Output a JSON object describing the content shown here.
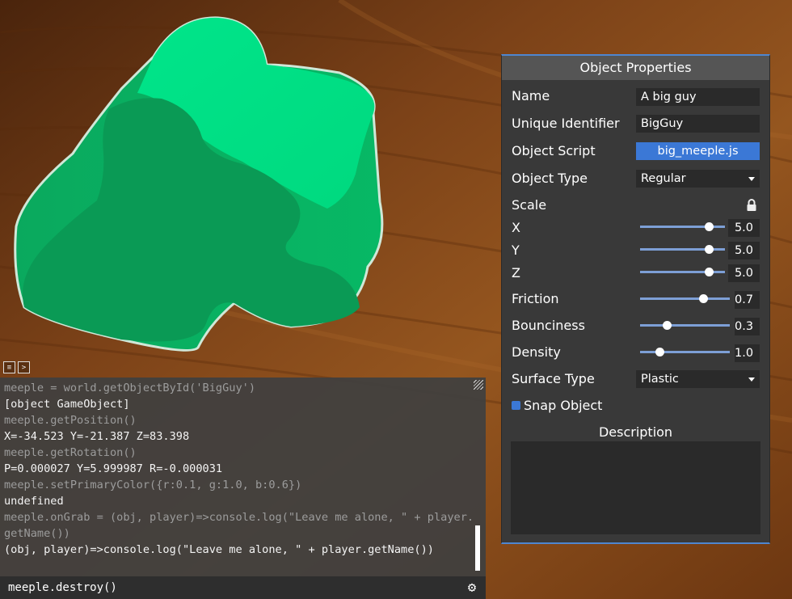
{
  "console": {
    "lines": [
      {
        "type": "cmd",
        "text": "meeple = world.getObjectById('BigGuy')"
      },
      {
        "type": "out",
        "text": "[object GameObject]"
      },
      {
        "type": "cmd",
        "text": "meeple.getPosition()"
      },
      {
        "type": "out",
        "text": "X=-34.523 Y=-21.387 Z=83.398"
      },
      {
        "type": "cmd",
        "text": "meeple.getRotation()"
      },
      {
        "type": "out",
        "text": "P=0.000027 Y=5.999987 R=-0.000031"
      },
      {
        "type": "cmd",
        "text": "meeple.setPrimaryColor({r:0.1, g:1.0, b:0.6})"
      },
      {
        "type": "out",
        "text": "undefined"
      },
      {
        "type": "cmd",
        "text": "meeple.onGrab = (obj, player)=>console.log(\"Leave me alone, \" + player.getName())"
      },
      {
        "type": "out",
        "text": "(obj, player)=>console.log(\"Leave me alone, \" + player.getName())"
      }
    ],
    "input_value": "meeple.destroy()",
    "tab_icons": [
      "chat-icon",
      "terminal-icon"
    ],
    "settings_icon": "gear-icon"
  },
  "panel": {
    "title": "Object Properties",
    "name_label": "Name",
    "name_value": "A big guy",
    "id_label": "Unique Identifier",
    "id_value": "BigGuy",
    "script_label": "Object Script",
    "script_value": "big_meeple.js",
    "type_label": "Object Type",
    "type_value": "Regular",
    "scale_label": "Scale",
    "scale_x_label": "X",
    "scale_x_value": "5.0",
    "scale_y_label": "Y",
    "scale_y_value": "5.0",
    "scale_z_label": "Z",
    "scale_z_value": "5.0",
    "scale_slider_level": 0.81,
    "friction_label": "Friction",
    "friction_value": "0.7",
    "friction_level": 0.7,
    "bounciness_label": "Bounciness",
    "bounciness_value": "0.3",
    "bounciness_level": 0.3,
    "density_label": "Density",
    "density_value": "1.0",
    "density_level": 0.22,
    "surface_label": "Surface Type",
    "surface_value": "Plastic",
    "snap_label": "Snap Object",
    "snap_checked": true,
    "description_label": "Description",
    "description_value": ""
  },
  "colors": {
    "accent": "#3b78d6",
    "panel_bg": "#393939",
    "field_bg": "#2a2a2a",
    "meeple_green": "#05c46b",
    "table_wood": "#7a4016"
  }
}
